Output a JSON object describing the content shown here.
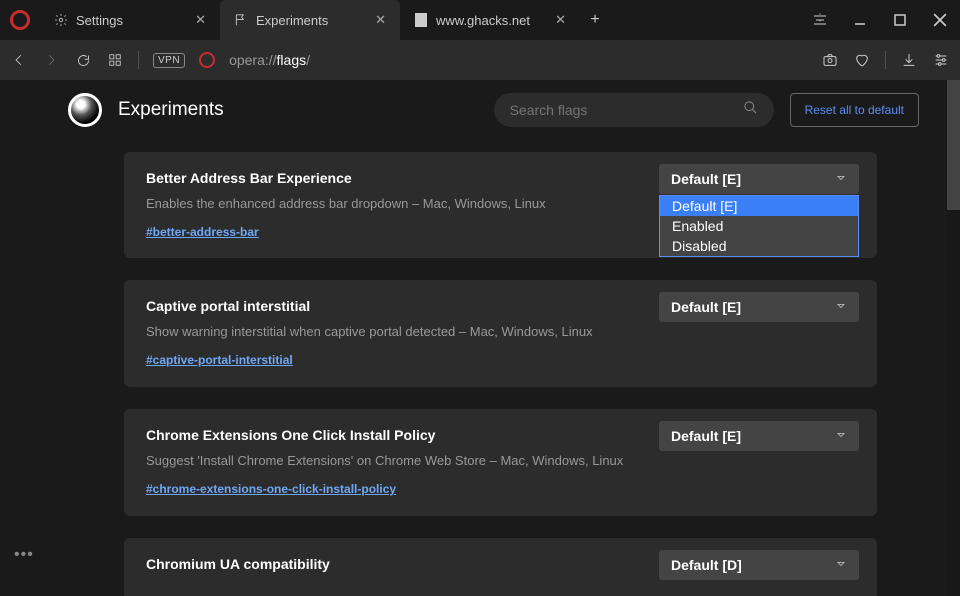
{
  "titlebar": {
    "tabs": [
      {
        "label": "Settings"
      },
      {
        "label": "Experiments"
      },
      {
        "label": "www.ghacks.net"
      }
    ]
  },
  "addr": {
    "vpn": "VPN",
    "url_prefix": "opera://",
    "url_highlight": "flags",
    "url_suffix": "/"
  },
  "page": {
    "title": "Experiments",
    "search_placeholder": "Search flags",
    "reset": "Reset all to default"
  },
  "flags": [
    {
      "title": "Better Address Bar Experience",
      "desc": "Enables the enhanced address bar dropdown – Mac, Windows, Linux",
      "link": "#better-address-bar",
      "value": "Default [E]",
      "open": true,
      "options": [
        "Default [E]",
        "Enabled",
        "Disabled"
      ]
    },
    {
      "title": "Captive portal interstitial",
      "desc": "Show warning interstitial when captive portal detected – Mac, Windows, Linux",
      "link": "#captive-portal-interstitial",
      "value": "Default [E]"
    },
    {
      "title": "Chrome Extensions One Click Install Policy",
      "desc": "Suggest 'Install Chrome Extensions' on Chrome Web Store – Mac, Windows, Linux",
      "link": "#chrome-extensions-one-click-install-policy",
      "value": "Default [E]"
    },
    {
      "title": "Chromium UA compatibility",
      "desc": "",
      "link": "",
      "value": "Default [D]"
    }
  ]
}
